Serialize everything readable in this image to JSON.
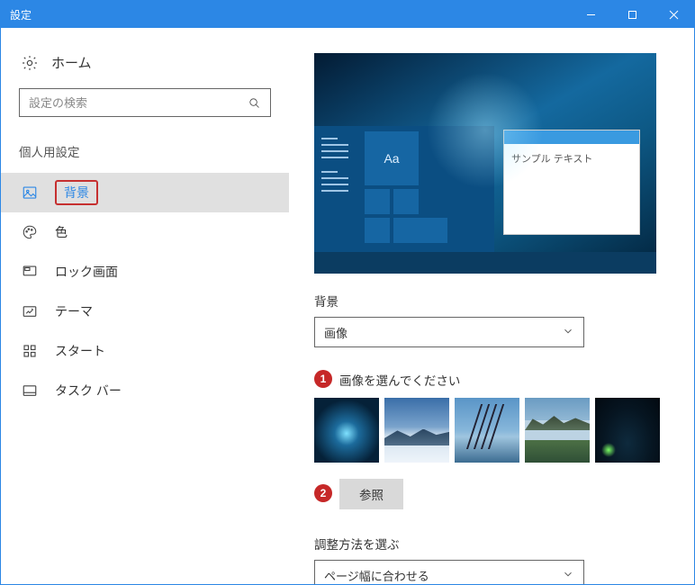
{
  "window": {
    "title": "設定"
  },
  "sidebar": {
    "home_label": "ホーム",
    "search_placeholder": "設定の検索",
    "section_title": "個人用設定",
    "items": [
      {
        "icon": "picture-icon",
        "label": "背景",
        "selected": true
      },
      {
        "icon": "palette-icon",
        "label": "色"
      },
      {
        "icon": "monitor-icon",
        "label": "ロック画面"
      },
      {
        "icon": "pencil-icon",
        "label": "テーマ"
      },
      {
        "icon": "grid-icon",
        "label": "スタート"
      },
      {
        "icon": "taskbar-icon",
        "label": "タスク バー"
      }
    ]
  },
  "preview": {
    "popup_text": "サンプル テキスト",
    "tile_text": "Aa"
  },
  "background": {
    "label": "背景",
    "dropdown_value": "画像"
  },
  "choose_image": {
    "annotation": "1",
    "label": "画像を選んでください"
  },
  "browse": {
    "annotation": "2",
    "label": "参照"
  },
  "fit": {
    "label": "調整方法を選ぶ",
    "dropdown_value": "ページ幅に合わせる"
  }
}
